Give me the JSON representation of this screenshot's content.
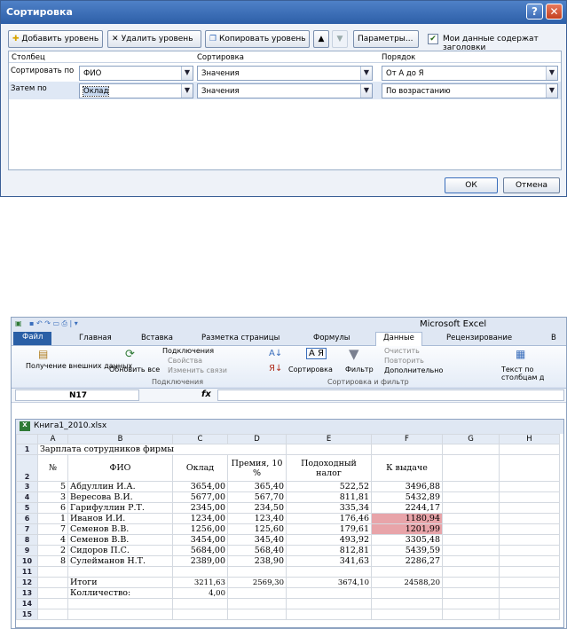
{
  "dialog": {
    "title": "Сортировка",
    "help_symbol": "?",
    "close_symbol": "✕",
    "toolbar": {
      "add_level": "Добавить уровень",
      "delete_level": "Удалить уровень",
      "copy_level": "Копировать уровень",
      "move_up": "▲",
      "move_down": "▼",
      "options": "Параметры...",
      "headers_checkbox_label": "Мои данные содержат заголовки",
      "headers_checked": true
    },
    "columns": {
      "column": "Столбец",
      "sort_on": "Сортировка",
      "order": "Порядок"
    },
    "rows": [
      {
        "label": "Сортировать по",
        "column": "ФИО",
        "sort_on": "Значения",
        "order": "От А до Я"
      },
      {
        "label": "Затем по",
        "column": "Оклад",
        "sort_on": "Значения",
        "order": "По возрастанию"
      }
    ],
    "ok": "ОК",
    "cancel": "Отмена"
  },
  "excel": {
    "app_title": "Microsoft Excel",
    "tabs": [
      "Файл",
      "Главная",
      "Вставка",
      "Разметка страницы",
      "Формулы",
      "Данные",
      "Рецензирование",
      "В"
    ],
    "active_tab": "Данные",
    "ribbon": {
      "get_external": "Получение внешних данных",
      "refresh_all": "Обновить все",
      "connections": "Подключения",
      "properties": "Свойства",
      "edit_links": "Изменить связи",
      "group_connections": "Подключения",
      "sort": "Сортировка",
      "filter": "Фильтр",
      "clear": "Очистить",
      "reapply": "Повторить",
      "advanced": "Дополнительно",
      "group_sort_filter": "Сортировка и фильтр",
      "text_to_columns": "Текст по столбцам д"
    },
    "name_box": "N17",
    "fx_symbol": "fx",
    "workbook_title": "Книга1_2010.xlsx",
    "col_headers": [
      "A",
      "B",
      "C",
      "D",
      "E",
      "F",
      "G",
      "H"
    ],
    "sheet_title": "Зарплата сотрудников фирмы",
    "headers": {
      "num": "№",
      "name": "ФИО",
      "salary": "Оклад",
      "bonus": "Премия, 10 %",
      "tax": "Подоходный налог",
      "payout": "К выдаче"
    },
    "rows": [
      {
        "row": "3",
        "num": "5",
        "name": "Абдуллин И.А.",
        "salary": "3654,00",
        "bonus": "365,40",
        "tax": "522,52",
        "payout": "3496,88",
        "hl": false
      },
      {
        "row": "4",
        "num": "3",
        "name": "Вересова В.И.",
        "salary": "5677,00",
        "bonus": "567,70",
        "tax": "811,81",
        "payout": "5432,89",
        "hl": false
      },
      {
        "row": "5",
        "num": "6",
        "name": "Гарифуллин Р.Т.",
        "salary": "2345,00",
        "bonus": "234,50",
        "tax": "335,34",
        "payout": "2244,17",
        "hl": false
      },
      {
        "row": "6",
        "num": "1",
        "name": "Иванов И.И.",
        "salary": "1234,00",
        "bonus": "123,40",
        "tax": "176,46",
        "payout": "1180,94",
        "hl": true
      },
      {
        "row": "7",
        "num": "7",
        "name": "Семенов В.В.",
        "salary": "1256,00",
        "bonus": "125,60",
        "tax": "179,61",
        "payout": "1201,99",
        "hl": true
      },
      {
        "row": "8",
        "num": "4",
        "name": "Семенов В.В.",
        "salary": "3454,00",
        "bonus": "345,40",
        "tax": "493,92",
        "payout": "3305,48",
        "hl": false
      },
      {
        "row": "9",
        "num": "2",
        "name": "Сидоров П.С.",
        "salary": "5684,00",
        "bonus": "568,40",
        "tax": "812,81",
        "payout": "5439,59",
        "hl": false
      },
      {
        "row": "10",
        "num": "8",
        "name": "Сулейманов Н.Т.",
        "salary": "2389,00",
        "bonus": "238,90",
        "tax": "341,63",
        "payout": "2286,27",
        "hl": false
      }
    ],
    "totals_label": "Итоги",
    "totals": {
      "salary": "3211,63",
      "bonus": "2569,30",
      "tax": "3674,10",
      "payout": "24588,20"
    },
    "count_label": "Колличество:",
    "count_value": "4,00",
    "empty_rows": [
      "11",
      "14",
      "15"
    ]
  }
}
